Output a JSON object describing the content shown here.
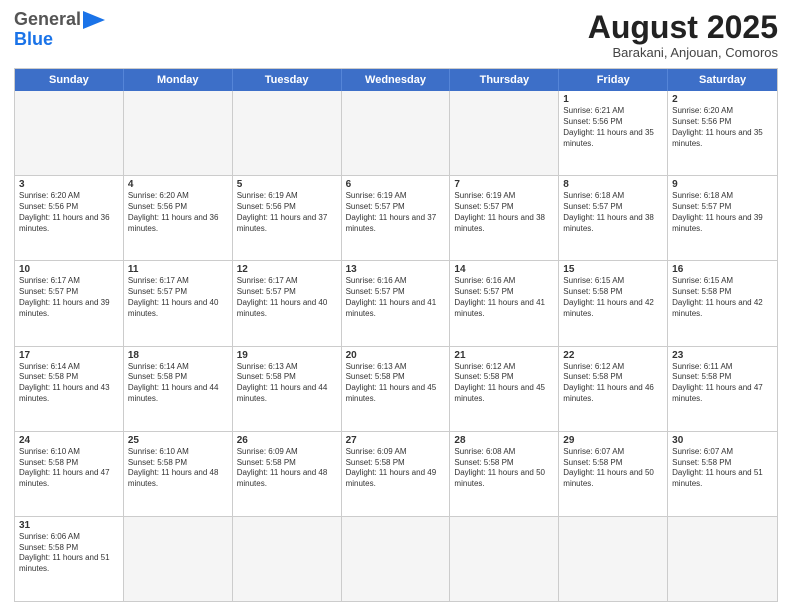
{
  "header": {
    "logo_general": "General",
    "logo_blue": "Blue",
    "month_title": "August 2025",
    "subtitle": "Barakani, Anjouan, Comoros"
  },
  "weekdays": [
    "Sunday",
    "Monday",
    "Tuesday",
    "Wednesday",
    "Thursday",
    "Friday",
    "Saturday"
  ],
  "rows": [
    [
      {
        "day": "",
        "info": ""
      },
      {
        "day": "",
        "info": ""
      },
      {
        "day": "",
        "info": ""
      },
      {
        "day": "",
        "info": ""
      },
      {
        "day": "",
        "info": ""
      },
      {
        "day": "1",
        "info": "Sunrise: 6:21 AM\nSunset: 5:56 PM\nDaylight: 11 hours and 35 minutes."
      },
      {
        "day": "2",
        "info": "Sunrise: 6:20 AM\nSunset: 5:56 PM\nDaylight: 11 hours and 35 minutes."
      }
    ],
    [
      {
        "day": "3",
        "info": "Sunrise: 6:20 AM\nSunset: 5:56 PM\nDaylight: 11 hours and 36 minutes."
      },
      {
        "day": "4",
        "info": "Sunrise: 6:20 AM\nSunset: 5:56 PM\nDaylight: 11 hours and 36 minutes."
      },
      {
        "day": "5",
        "info": "Sunrise: 6:19 AM\nSunset: 5:56 PM\nDaylight: 11 hours and 37 minutes."
      },
      {
        "day": "6",
        "info": "Sunrise: 6:19 AM\nSunset: 5:57 PM\nDaylight: 11 hours and 37 minutes."
      },
      {
        "day": "7",
        "info": "Sunrise: 6:19 AM\nSunset: 5:57 PM\nDaylight: 11 hours and 38 minutes."
      },
      {
        "day": "8",
        "info": "Sunrise: 6:18 AM\nSunset: 5:57 PM\nDaylight: 11 hours and 38 minutes."
      },
      {
        "day": "9",
        "info": "Sunrise: 6:18 AM\nSunset: 5:57 PM\nDaylight: 11 hours and 39 minutes."
      }
    ],
    [
      {
        "day": "10",
        "info": "Sunrise: 6:17 AM\nSunset: 5:57 PM\nDaylight: 11 hours and 39 minutes."
      },
      {
        "day": "11",
        "info": "Sunrise: 6:17 AM\nSunset: 5:57 PM\nDaylight: 11 hours and 40 minutes."
      },
      {
        "day": "12",
        "info": "Sunrise: 6:17 AM\nSunset: 5:57 PM\nDaylight: 11 hours and 40 minutes."
      },
      {
        "day": "13",
        "info": "Sunrise: 6:16 AM\nSunset: 5:57 PM\nDaylight: 11 hours and 41 minutes."
      },
      {
        "day": "14",
        "info": "Sunrise: 6:16 AM\nSunset: 5:57 PM\nDaylight: 11 hours and 41 minutes."
      },
      {
        "day": "15",
        "info": "Sunrise: 6:15 AM\nSunset: 5:58 PM\nDaylight: 11 hours and 42 minutes."
      },
      {
        "day": "16",
        "info": "Sunrise: 6:15 AM\nSunset: 5:58 PM\nDaylight: 11 hours and 42 minutes."
      }
    ],
    [
      {
        "day": "17",
        "info": "Sunrise: 6:14 AM\nSunset: 5:58 PM\nDaylight: 11 hours and 43 minutes."
      },
      {
        "day": "18",
        "info": "Sunrise: 6:14 AM\nSunset: 5:58 PM\nDaylight: 11 hours and 44 minutes."
      },
      {
        "day": "19",
        "info": "Sunrise: 6:13 AM\nSunset: 5:58 PM\nDaylight: 11 hours and 44 minutes."
      },
      {
        "day": "20",
        "info": "Sunrise: 6:13 AM\nSunset: 5:58 PM\nDaylight: 11 hours and 45 minutes."
      },
      {
        "day": "21",
        "info": "Sunrise: 6:12 AM\nSunset: 5:58 PM\nDaylight: 11 hours and 45 minutes."
      },
      {
        "day": "22",
        "info": "Sunrise: 6:12 AM\nSunset: 5:58 PM\nDaylight: 11 hours and 46 minutes."
      },
      {
        "day": "23",
        "info": "Sunrise: 6:11 AM\nSunset: 5:58 PM\nDaylight: 11 hours and 47 minutes."
      }
    ],
    [
      {
        "day": "24",
        "info": "Sunrise: 6:10 AM\nSunset: 5:58 PM\nDaylight: 11 hours and 47 minutes."
      },
      {
        "day": "25",
        "info": "Sunrise: 6:10 AM\nSunset: 5:58 PM\nDaylight: 11 hours and 48 minutes."
      },
      {
        "day": "26",
        "info": "Sunrise: 6:09 AM\nSunset: 5:58 PM\nDaylight: 11 hours and 48 minutes."
      },
      {
        "day": "27",
        "info": "Sunrise: 6:09 AM\nSunset: 5:58 PM\nDaylight: 11 hours and 49 minutes."
      },
      {
        "day": "28",
        "info": "Sunrise: 6:08 AM\nSunset: 5:58 PM\nDaylight: 11 hours and 50 minutes."
      },
      {
        "day": "29",
        "info": "Sunrise: 6:07 AM\nSunset: 5:58 PM\nDaylight: 11 hours and 50 minutes."
      },
      {
        "day": "30",
        "info": "Sunrise: 6:07 AM\nSunset: 5:58 PM\nDaylight: 11 hours and 51 minutes."
      }
    ],
    [
      {
        "day": "31",
        "info": "Sunrise: 6:06 AM\nSunset: 5:58 PM\nDaylight: 11 hours and 51 minutes."
      },
      {
        "day": "",
        "info": ""
      },
      {
        "day": "",
        "info": ""
      },
      {
        "day": "",
        "info": ""
      },
      {
        "day": "",
        "info": ""
      },
      {
        "day": "",
        "info": ""
      },
      {
        "day": "",
        "info": ""
      }
    ]
  ]
}
